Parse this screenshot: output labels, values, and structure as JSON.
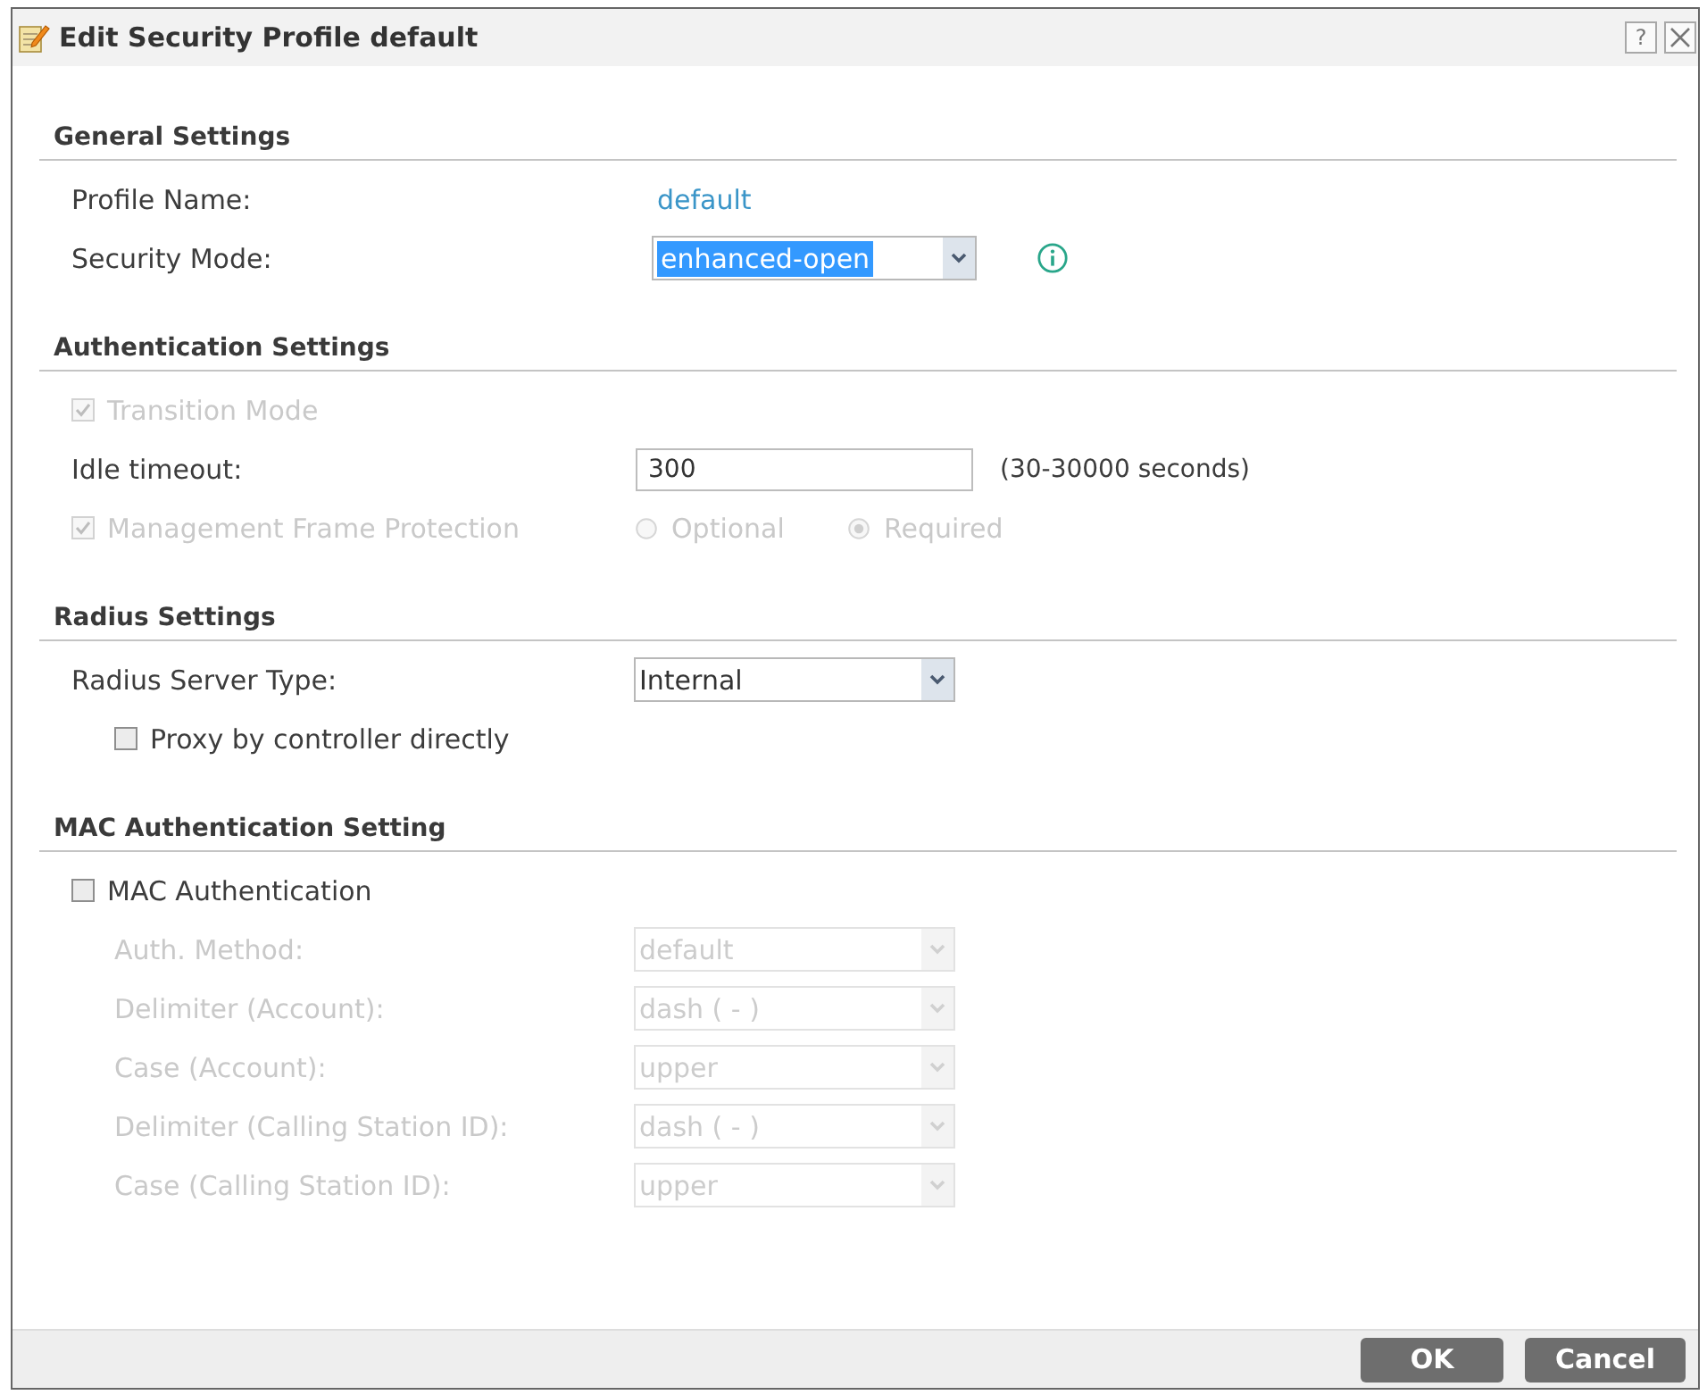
{
  "window": {
    "title": "Edit Security Profile default",
    "help": "?"
  },
  "general_settings": {
    "title": "General Settings",
    "profile_name": {
      "label": "Profile Name:",
      "value": "default"
    },
    "security_mode": {
      "label": "Security Mode:",
      "value": "enhanced-open",
      "text_selected": true
    }
  },
  "authentication_settings": {
    "title": "Authentication Settings",
    "transition_mode": {
      "label": "Transition Mode",
      "checked": true,
      "disabled": true
    },
    "idle_timeout": {
      "label": "Idle timeout:",
      "value": "300",
      "hint": "(30-30000 seconds)"
    },
    "management_frame_protection": {
      "label": "Management Frame Protection",
      "checked": true,
      "disabled": true,
      "options": [
        {
          "label": "Optional",
          "selected": false
        },
        {
          "label": "Required",
          "selected": true
        }
      ]
    }
  },
  "radius_settings": {
    "title": "Radius Settings",
    "server_type": {
      "label": "Radius Server Type:",
      "value": "Internal"
    },
    "proxy_by_controller": {
      "label": "Proxy by controller directly",
      "checked": false
    }
  },
  "mac_authentication_setting": {
    "title": "MAC Authentication Setting",
    "mac_authentication": {
      "label": "MAC Authentication",
      "checked": false
    },
    "fields": [
      {
        "label": "Auth. Method:",
        "value": "default",
        "disabled": true
      },
      {
        "label": "Delimiter (Account):",
        "value": "dash ( - )",
        "disabled": true
      },
      {
        "label": "Case (Account):",
        "value": "upper",
        "disabled": true
      },
      {
        "label": "Delimiter (Calling Station ID):",
        "value": "dash ( - )",
        "disabled": true
      },
      {
        "label": "Case (Calling Station ID):",
        "value": "upper",
        "disabled": true
      }
    ]
  },
  "buttons": [
    "OK",
    "Cancel"
  ]
}
